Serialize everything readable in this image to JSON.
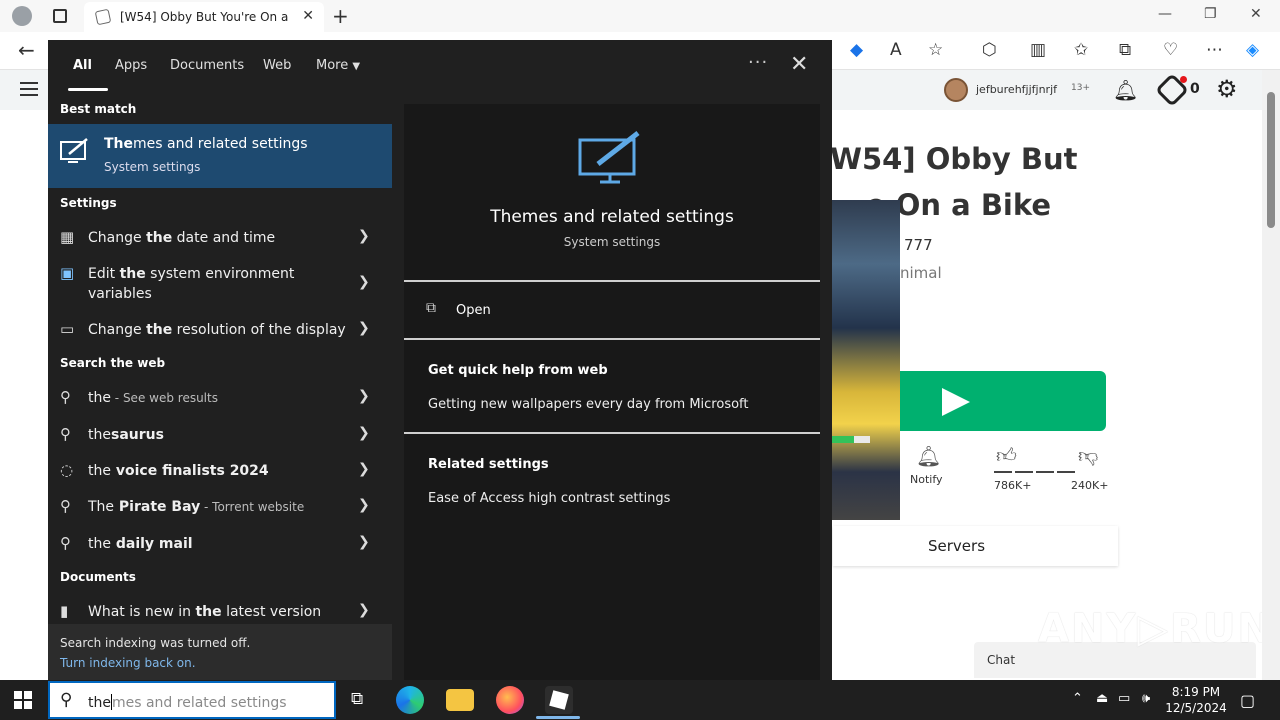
{
  "browser": {
    "tab_title": "[W54] Obby But You're On a Bike",
    "tab_close": "✕",
    "new_tab": "+",
    "window_controls": {
      "minimize": "—",
      "restore": "❐",
      "close": "✕"
    }
  },
  "page": {
    "username": "jefburehfjjfjnrjf",
    "age_badge": "13+",
    "robux": "0",
    "game_title_line1": "W54] Obby But",
    "game_title_line2": "e On a Bike",
    "creator_id": "777",
    "creator_name": "nimal",
    "notify_label": "Notify",
    "upvotes": "786K+",
    "downvotes": "240K+",
    "servers_label": "Servers",
    "chat_label": "Chat",
    "watermark": "ANY▷RUN"
  },
  "flyout": {
    "tabs": {
      "all": "All",
      "apps": "Apps",
      "documents": "Documents",
      "web": "Web",
      "more": "More"
    },
    "more_options": "···",
    "close": "✕",
    "best_match_heading": "Best match",
    "best_match": {
      "title_bold": "The",
      "title_rest": "mes and related settings",
      "subtitle": "System settings"
    },
    "settings_heading": "Settings",
    "settings_items": [
      {
        "pre": "Change ",
        "bold": "the",
        "post": " date and time"
      },
      {
        "pre": "Edit ",
        "bold": "the",
        "post": " system environment",
        "line2": "variables"
      },
      {
        "pre": "Change ",
        "bold": "the",
        "post": " resolution of the display"
      }
    ],
    "web_heading": "Search the web",
    "web_items": [
      {
        "pre": "the",
        "bold": "",
        "post": "",
        "suffix": " - See web results"
      },
      {
        "pre": "the",
        "bold": "saurus",
        "post": "",
        "suffix": ""
      },
      {
        "pre": "the",
        "bold": " voice finalists 2024",
        "post": "",
        "suffix": ""
      },
      {
        "pre": "The",
        "bold": " Pirate Bay",
        "post": "",
        "suffix": " - Torrent website"
      },
      {
        "pre": "the",
        "bold": " daily mail",
        "post": "",
        "suffix": ""
      }
    ],
    "documents_heading": "Documents",
    "document_item": {
      "pre": "What is new in ",
      "bold": "the",
      "post": " latest version"
    },
    "indexing_off": "Search indexing was turned off.",
    "indexing_link": "Turn indexing back on.",
    "preview": {
      "title": "Themes and related settings",
      "subtitle": "System settings",
      "open": "Open",
      "quick_help_heading": "Get quick help from web",
      "quick_help_item": "Getting new wallpapers every day from Microsoft",
      "related_heading": "Related settings",
      "related_item": "Ease of Access high contrast settings"
    }
  },
  "taskbar": {
    "search_typed": "the",
    "search_hint": "mes and related settings",
    "time": "8:19 PM",
    "date": "12/5/2024"
  },
  "colors": {
    "accent": "#0067c0",
    "best_match_bg": "#1e4a70",
    "play_green": "#00b06f"
  }
}
